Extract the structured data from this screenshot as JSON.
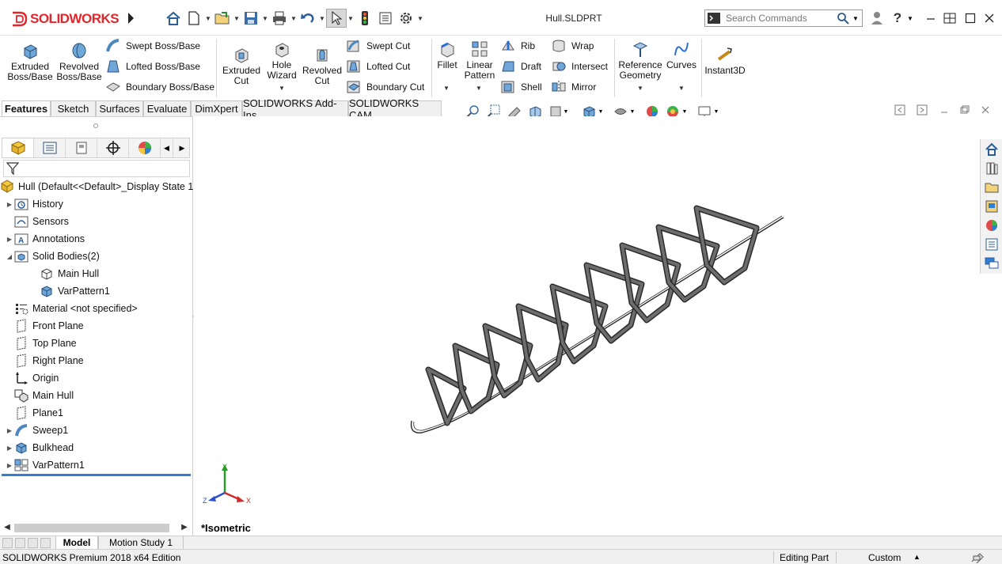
{
  "app": {
    "logo_text": "SOLIDWORKS",
    "document_title": "Hull.SLDPRT",
    "search_placeholder": "Search Commands"
  },
  "colors": {
    "logo_red": "#e2262b",
    "accent_blue": "#2f7fd6",
    "model_stroke": "#2a2a2a",
    "model_fill": "#6d6d6d"
  },
  "quick_access": [
    "home-icon",
    "new-document-icon",
    "open-folder-icon",
    "save-icon",
    "print-icon",
    "undo-icon",
    "select-arrow-icon",
    "rebuild-traffic-light-icon",
    "file-properties-icon",
    "options-gear-icon"
  ],
  "command_manager": {
    "extruded_boss": "Extruded\nBoss/Base",
    "revolved_boss": "Revolved\nBoss/Base",
    "swept_boss": "Swept Boss/Base",
    "lofted_boss": "Lofted Boss/Base",
    "boundary_boss": "Boundary Boss/Base",
    "extruded_cut": "Extruded\nCut",
    "hole_wizard": "Hole\nWizard",
    "revolved_cut": "Revolved\nCut",
    "swept_cut": "Swept Cut",
    "lofted_cut": "Lofted Cut",
    "boundary_cut": "Boundary Cut",
    "fillet": "Fillet",
    "linear_pattern": "Linear\nPattern",
    "rib": "Rib",
    "draft": "Draft",
    "shell": "Shell",
    "wrap": "Wrap",
    "intersect": "Intersect",
    "mirror": "Mirror",
    "reference_geometry": "Reference\nGeometry",
    "curves": "Curves",
    "instant3d": "Instant3D"
  },
  "tabs": [
    {
      "label": "Features",
      "active": true
    },
    {
      "label": "Sketch",
      "active": false
    },
    {
      "label": "Surfaces",
      "active": false
    },
    {
      "label": "Evaluate",
      "active": false
    },
    {
      "label": "DimXpert",
      "active": false
    },
    {
      "label": "SOLIDWORKS Add-Ins",
      "active": false
    },
    {
      "label": "SOLIDWORKS CAM",
      "active": false
    }
  ],
  "feature_tree": {
    "root": "Hull  (Default<<Default>_Display State 1",
    "items": [
      {
        "label": "History",
        "expandable": true,
        "expanded": false,
        "indent": 0,
        "icon": "history-folder-icon"
      },
      {
        "label": "Sensors",
        "expandable": false,
        "expanded": false,
        "indent": 0,
        "icon": "sensors-folder-icon"
      },
      {
        "label": "Annotations",
        "expandable": true,
        "expanded": false,
        "indent": 0,
        "icon": "annotations-folder-icon"
      },
      {
        "label": "Solid Bodies(2)",
        "expandable": true,
        "expanded": true,
        "indent": 0,
        "icon": "solid-bodies-folder-icon"
      },
      {
        "label": "Main Hull",
        "expandable": false,
        "expanded": false,
        "indent": 1,
        "icon": "body-outline-icon"
      },
      {
        "label": "VarPattern1",
        "expandable": false,
        "expanded": false,
        "indent": 1,
        "icon": "body-solid-icon"
      },
      {
        "label": "Material <not specified>",
        "expandable": false,
        "expanded": false,
        "indent": 0,
        "icon": "material-icon"
      },
      {
        "label": "Front Plane",
        "expandable": false,
        "expanded": false,
        "indent": 0,
        "icon": "plane-icon"
      },
      {
        "label": "Top Plane",
        "expandable": false,
        "expanded": false,
        "indent": 0,
        "icon": "plane-icon"
      },
      {
        "label": "Right Plane",
        "expandable": false,
        "expanded": false,
        "indent": 0,
        "icon": "plane-icon"
      },
      {
        "label": "Origin",
        "expandable": false,
        "expanded": false,
        "indent": 0,
        "icon": "origin-icon"
      },
      {
        "label": "Main Hull",
        "expandable": false,
        "expanded": false,
        "indent": 0,
        "icon": "derived-part-icon"
      },
      {
        "label": "Plane1",
        "expandable": false,
        "expanded": false,
        "indent": 0,
        "icon": "plane-icon"
      },
      {
        "label": "Sweep1",
        "expandable": true,
        "expanded": false,
        "indent": 0,
        "icon": "sweep-icon"
      },
      {
        "label": "Bulkhead",
        "expandable": true,
        "expanded": false,
        "indent": 0,
        "icon": "extrude-icon"
      },
      {
        "label": "VarPattern1",
        "expandable": true,
        "expanded": false,
        "indent": 0,
        "icon": "variable-pattern-icon"
      }
    ]
  },
  "graphics": {
    "view_label": "*Isometric",
    "triad": {
      "x": "X",
      "y": "Y",
      "z": "Z"
    }
  },
  "bottom_tabs": [
    {
      "label": "Model",
      "active": true
    },
    {
      "label": "Motion Study 1",
      "active": false
    }
  ],
  "status_bar": {
    "edition": "SOLIDWORKS Premium 2018 x64 Edition",
    "mode": "Editing Part",
    "units": "Custom"
  }
}
